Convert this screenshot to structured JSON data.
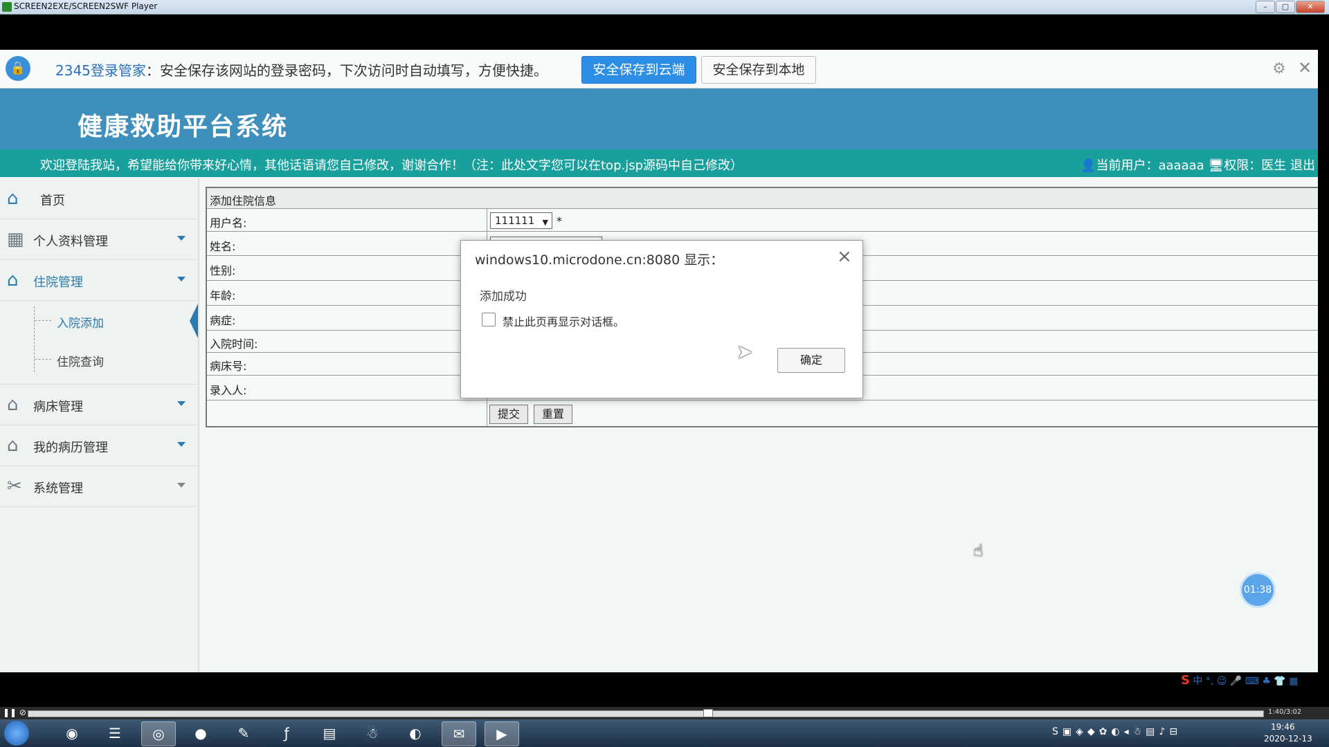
{
  "player": {
    "title": "SCREEN2EXE/SCREEN2SWF Player",
    "progress_time": "1:40/3:02",
    "progress_fraction": 0.55
  },
  "password_bar": {
    "brand": "2345登录管家",
    "message": "：安全保存该网站的登录密码，下次访问时自动填写，方便快捷。",
    "save_cloud": "安全保存到云端",
    "save_local": "安全保存到本地"
  },
  "site": {
    "title": "健康救助平台系统",
    "welcome": "欢迎登陆我站，希望能给你带来好心情，其他话语请您自己修改，谢谢合作！（注：此处文字您可以在top.jsp源码中自己修改）",
    "current_user_label": "当前用户：",
    "current_user": "aaaaaa",
    "role_label": "权限：",
    "role": "医生",
    "logout": "退出"
  },
  "sidebar": {
    "home": "首页",
    "personal": "个人资料管理",
    "hospital": "住院管理",
    "sub_add": "入院添加",
    "sub_query": "住院查询",
    "bed": "病床管理",
    "records": "我的病历管理",
    "system": "系统管理"
  },
  "form": {
    "heading": "添加住院信息",
    "labels": {
      "username": "用户名:",
      "name": "姓名:",
      "gender": "性别:",
      "age": "年龄:",
      "disease": "病症:",
      "admit_time": "入院时间:",
      "bed_no": "病床号:",
      "entered_by": "录入人:"
    },
    "username_value": "111111",
    "required_mark": "*",
    "submit": "提交",
    "reset": "重置"
  },
  "dialog": {
    "title": "windows10.microdone.cn:8080 显示：",
    "message": "添加成功",
    "checkbox_label": "禁止此页再显示对话框。",
    "ok": "确定"
  },
  "timer": "01:38",
  "ime": {
    "logo": "S",
    "mode": "中"
  },
  "taskbar": {
    "time": "19:46",
    "date": "2020-12-13"
  }
}
